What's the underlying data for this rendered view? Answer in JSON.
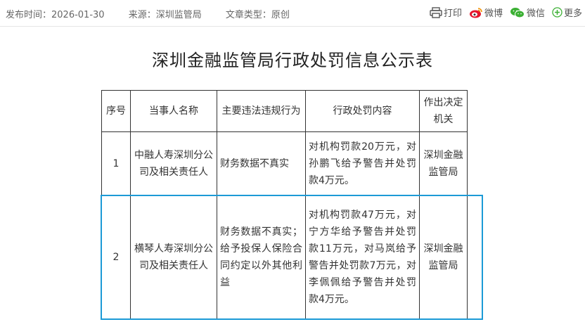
{
  "meta": {
    "publish_label": "发布时间：",
    "publish_date": "2026-01-30",
    "source_label": "来源：",
    "source": "深圳监管局",
    "type_label": "文章类型：",
    "type": "原创"
  },
  "share": {
    "print": "打印",
    "weibo": "微博",
    "wechat": "微信",
    "more": "更多"
  },
  "title": "深圳金融监管局行政处罚信息公示表",
  "table": {
    "headers": [
      "序号",
      "当事人名称",
      "主要违法违规行为",
      "行政处罚内容",
      "作出决定机关"
    ],
    "rows": [
      {
        "no": "1",
        "party": "中融人寿深圳分公司及相关责任人",
        "violation": "财务数据不真实",
        "penalty": "对机构罚款20万元，对孙鹏飞给予警告并处罚款4万元。",
        "authority": "深圳金融监管局"
      },
      {
        "no": "2",
        "party": "横琴人寿深圳分公司及相关责任人",
        "violation": "财务数据不真实；给予投保人保险合同约定以外其他利益",
        "penalty": "对机构罚款47万元，对宁方华给予警告并处罚款11万元，对马岚给予警告并处罚款7万元，对李佩佩给予警告并处罚款4万元。",
        "authority": "深圳金融监管局"
      }
    ]
  },
  "colors": {
    "highlight": "#1c9ad6",
    "weibo_red": "#e6162d",
    "wechat_green": "#3cb034",
    "more_green": "#3cb034"
  }
}
